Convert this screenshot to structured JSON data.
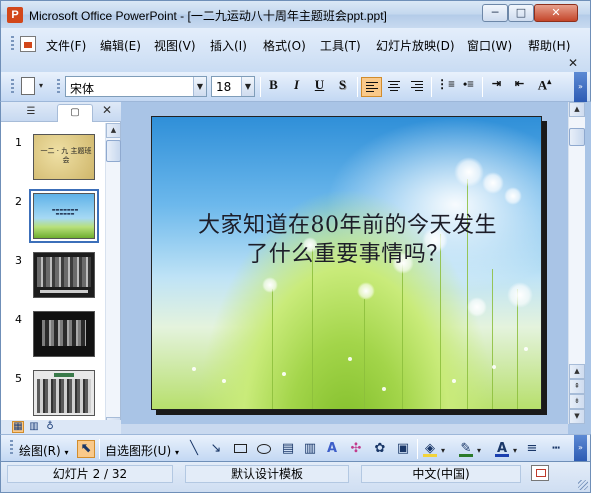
{
  "window": {
    "title": "Microsoft Office PowerPoint - [一二九运动八十周年主题班会ppt.ppt]",
    "icon": "powerpoint-icon",
    "minimize_label": "─",
    "maximize_label": "□",
    "close_label": "✕"
  },
  "menu": {
    "items": [
      "文件(F)",
      "编辑(E)",
      "视图(V)",
      "插入(I)",
      "格式(O)",
      "工具(T)",
      "幻灯片放映(D)",
      "窗口(W)",
      "帮助(H)"
    ],
    "close_label": "✕"
  },
  "format_toolbar": {
    "font_name": "宋体",
    "font_size": "18",
    "bold": "B",
    "italic": "I",
    "underline": "U",
    "shadow": "S",
    "grow_font": "A"
  },
  "slides_pane": {
    "tab_outline_icon": "outline-icon",
    "tab_slides_icon": "slides-icon",
    "close_label": "✕",
    "selected_index": 2,
    "thumbnails": [
      {
        "number": "1",
        "kind": "title",
        "text": "一二 · 九 主题班会"
      },
      {
        "number": "2",
        "kind": "sky"
      },
      {
        "number": "3",
        "kind": "photo"
      },
      {
        "number": "4",
        "kind": "photo"
      },
      {
        "number": "5",
        "kind": "photo"
      }
    ]
  },
  "slide": {
    "title_line1": "大家知道在80年前的今天发生",
    "title_line2": "了什么重要事情吗？"
  },
  "draw_toolbar": {
    "draw_label": "绘图(R)",
    "autoshapes_label": "自选图形(U)"
  },
  "status": {
    "slide_info": "幻灯片 2 / 32",
    "design": "默认设计模板",
    "language": "中文(中国)"
  },
  "colors": {
    "accent": "#f9c98a",
    "chrome": "#c3d8f3",
    "brand": "#d2471a",
    "font_color": "#1a3fb0",
    "line_color": "#2b7a2b",
    "fill_color": "#f2d33a"
  }
}
